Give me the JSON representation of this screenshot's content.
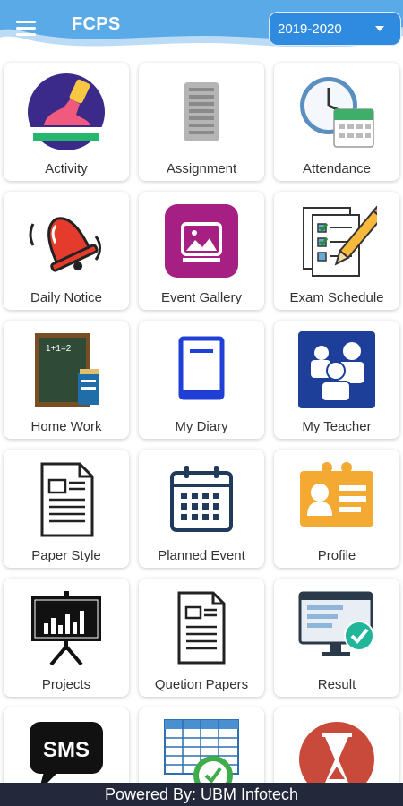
{
  "header": {
    "title": "FCPS",
    "menu_icon": "hamburger-menu-icon",
    "year_select": {
      "selected": "2019-2020",
      "icon": "chevron-down-icon"
    },
    "colors": {
      "wave": "#5aaae8",
      "wave_light": "#bcdcf5",
      "select_bg": "#2f8be0"
    }
  },
  "tiles": [
    {
      "label": "Activity",
      "icon": "running-shoe-icon"
    },
    {
      "label": "Assignment",
      "icon": "document-icon"
    },
    {
      "label": "Attendance",
      "icon": "clock-calendar-icon"
    },
    {
      "label": "Daily Notice",
      "icon": "bell-icon"
    },
    {
      "label": "Event Gallery",
      "icon": "gallery-image-icon"
    },
    {
      "label": "Exam Schedule",
      "icon": "checklist-pencil-icon"
    },
    {
      "label": "Home Work",
      "icon": "chalkboard-books-icon"
    },
    {
      "label": "My Diary",
      "icon": "diary-book-icon"
    },
    {
      "label": "My Teacher",
      "icon": "people-group-icon"
    },
    {
      "label": "Paper Style",
      "icon": "paper-document-icon"
    },
    {
      "label": "Planned Event",
      "icon": "calendar-icon"
    },
    {
      "label": "Profile",
      "icon": "id-card-icon"
    },
    {
      "label": "Projects",
      "icon": "presentation-board-icon"
    },
    {
      "label": "Quetion Papers",
      "icon": "question-paper-icon"
    },
    {
      "label": "Result",
      "icon": "monitor-check-icon"
    },
    {
      "label": "",
      "icon": "sms-bubble-icon",
      "icon_text": "SMS"
    },
    {
      "label": "",
      "icon": "spreadsheet-clock-icon"
    },
    {
      "label": "",
      "icon": "hourglass-icon"
    }
  ],
  "footer": {
    "text": "Powered By: UBM Infotech"
  }
}
